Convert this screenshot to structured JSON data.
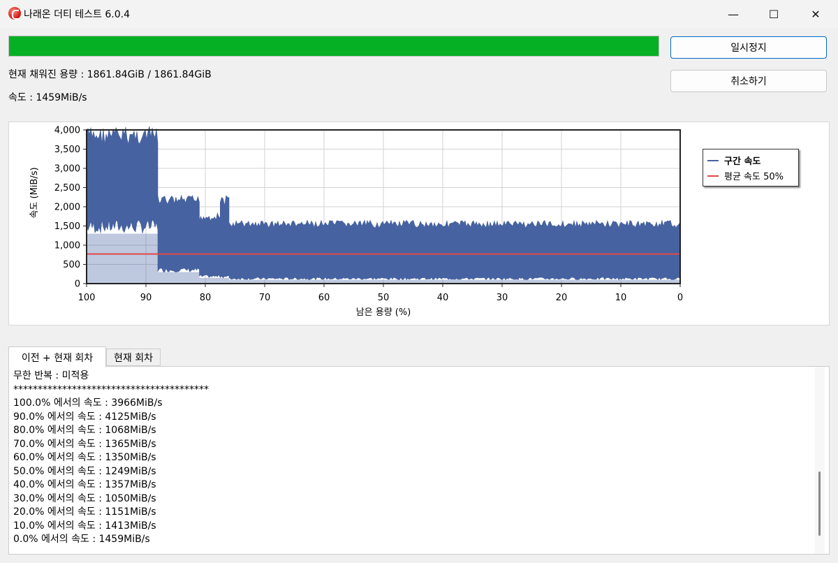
{
  "window": {
    "title": "나래온 더티 테스트 6.0.4",
    "controls": {
      "minimize": "—",
      "maximize": "☐",
      "close": "✕"
    }
  },
  "progress": {
    "value": 1.0,
    "color": "#06b025"
  },
  "status": {
    "filled_label": "현재 채워진 용량 : 1861.84GiB / 1861.84GiB",
    "speed_label": "속도 : 1459MiB/s"
  },
  "buttons": {
    "pause": "일시정지",
    "cancel": "취소하기"
  },
  "chart_data": {
    "type": "area",
    "xlabel": "남은 용량 (%)",
    "ylabel": "속도 (MiB/s)",
    "xlim": [
      100,
      0
    ],
    "ylim": [
      0,
      4000
    ],
    "x_ticks": [
      100,
      90,
      80,
      70,
      60,
      50,
      40,
      30,
      20,
      10,
      0
    ],
    "y_ticks": [
      0,
      500,
      1000,
      1500,
      2000,
      2500,
      3000,
      3500,
      4000
    ],
    "y_tick_labels": [
      "0",
      "500",
      "1,000",
      "1,500",
      "2,000",
      "2,500",
      "3,000",
      "3,500",
      "4,000"
    ],
    "grid": true,
    "legend_position": "right",
    "series": [
      {
        "name": "구간 속도",
        "color": "#4662a0",
        "segments": [
          {
            "x": [
              100,
              88
            ],
            "max": 4100,
            "min": 1300
          },
          {
            "x": [
              88,
              81
            ],
            "max": 2300,
            "min": 300
          },
          {
            "x": [
              81,
              77.5
            ],
            "max": 1850,
            "min": 150
          },
          {
            "x": [
              77.5,
              76
            ],
            "max": 2300,
            "min": 150
          },
          {
            "x": [
              76,
              0
            ],
            "max": 1650,
            "min": 100
          }
        ]
      },
      {
        "name": "평균 속도 50%",
        "color": "#e04848",
        "value": 770
      }
    ]
  },
  "tabs": [
    "이전 + 현재 회차",
    "현재 회차"
  ],
  "log": [
    "무한 반복 : 미적용",
    "****************************************",
    "100.0% 에서의 속도 : 3966MiB/s",
    "90.0% 에서의 속도 : 4125MiB/s",
    "80.0% 에서의 속도 : 1068MiB/s",
    "70.0% 에서의 속도 : 1365MiB/s",
    "60.0% 에서의 속도 : 1350MiB/s",
    "50.0% 에서의 속도 : 1249MiB/s",
    "40.0% 에서의 속도 : 1357MiB/s",
    "30.0% 에서의 속도 : 1050MiB/s",
    "20.0% 에서의 속도 : 1151MiB/s",
    "10.0% 에서의 속도 : 1413MiB/s",
    "0.0% 에서의 속도 : 1459MiB/s"
  ]
}
